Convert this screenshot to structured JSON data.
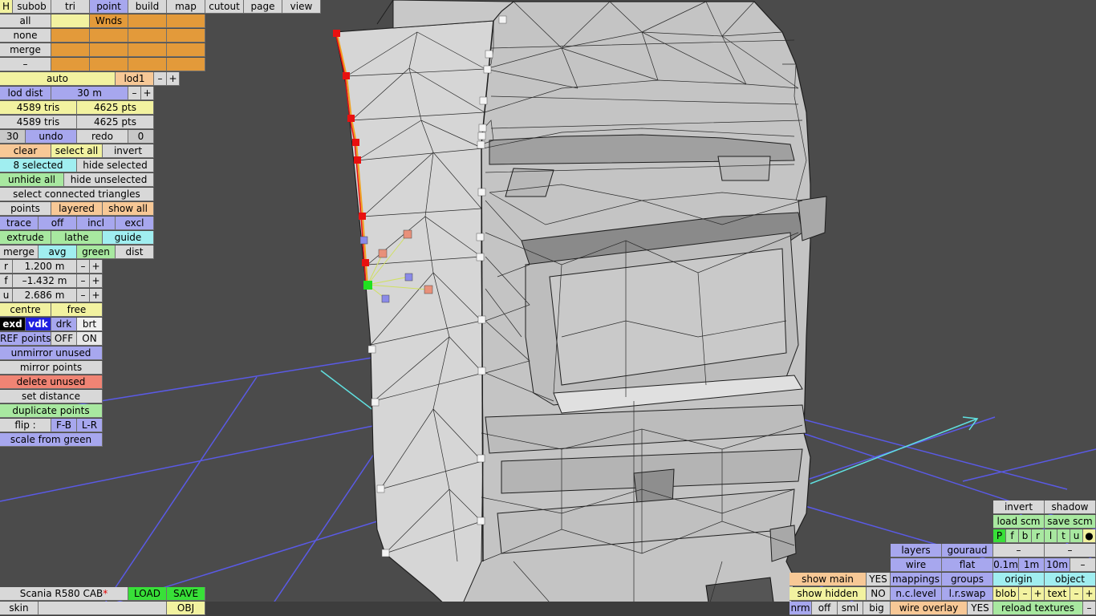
{
  "top_menu": {
    "h": "H",
    "subob": "subob",
    "tri": "tri",
    "point": "point",
    "build": "build",
    "map": "map",
    "cutout": "cutout",
    "page": "page",
    "view": "view"
  },
  "select_panel": {
    "all": "all",
    "none": "none",
    "merge": "merge",
    "dash": "–",
    "wnds": "Wnds"
  },
  "lod": {
    "auto": "auto",
    "lod1": "lod1",
    "minus": "–",
    "plus": "+",
    "lod_dist": "lod dist",
    "dist_value": "30 m"
  },
  "stats": {
    "tris_1": "4589 tris",
    "pts_1": "4625 pts",
    "tris_2": "4589 tris",
    "pts_2": "4625 pts"
  },
  "undo": {
    "count_left": "30",
    "undo": "undo",
    "redo": "redo",
    "count_right": "0"
  },
  "selection": {
    "clear": "clear",
    "select_all": "select all",
    "invert": "invert",
    "selected": "8 selected",
    "hide_selected": "hide selected",
    "unhide_all": "unhide all",
    "hide_unselected": "hide unselected",
    "select_connected": "select connected triangles"
  },
  "modes": {
    "points": "points",
    "layered": "layered",
    "show_all": "show all",
    "trace": "trace",
    "off": "off",
    "incl": "incl",
    "excl": "excl",
    "extrude": "extrude",
    "lathe": "lathe",
    "guide": "guide",
    "merge": "merge",
    "avg": "avg",
    "green": "green",
    "dist": "dist"
  },
  "coords": {
    "r_label": "r",
    "r_value": "1.200 m",
    "f_label": "f",
    "f_value": "–1.432 m",
    "u_label": "u",
    "u_value": "2.686 m",
    "minus": "–",
    "plus": "+"
  },
  "tools": {
    "centre": "centre",
    "free": "free",
    "exd": "exd",
    "vdk": "vdk",
    "drk": "drk",
    "brt": "brt",
    "ref_points": "REF points",
    "ref_off": "OFF",
    "ref_on": "ON",
    "unmirror_unused": "unmirror unused",
    "mirror_points": "mirror points",
    "delete_unused": "delete unused",
    "set_distance": "set distance",
    "duplicate_points": "duplicate points",
    "flip": "flip :",
    "flip_fb": "F-B",
    "flip_lr": "L-R",
    "scale_from_green": "scale from green"
  },
  "file_bar": {
    "model_name": "Scania R580 CAB",
    "modified_star": "*",
    "load": "LOAD",
    "save": "SAVE",
    "skin": "skin",
    "obj": "OBJ"
  },
  "view_panel": {
    "invert": "invert",
    "shadow": "shadow",
    "load_scm": "load scm",
    "save_scm": "save scm",
    "letters": [
      "P",
      "f",
      "b",
      "r",
      "l",
      "t",
      "u",
      "●"
    ],
    "dash": "–",
    "layers": "layers",
    "gouraud": "gouraud",
    "wire": "wire",
    "flat": "flat",
    "mappings": "mappings",
    "groups": "groups",
    "nc_level": "n.c.level",
    "lr_swap": "l.r.swap",
    "wire_overlay": "wire overlay",
    "wire_overlay_value": "YES",
    "g01": "0.1m",
    "g1": "1m",
    "g10": "10m",
    "origin": "origin",
    "object": "object",
    "blob": "blob",
    "text": "text",
    "minus": "–",
    "plus": "+",
    "reload_textures": "reload textures",
    "show_main": "show main",
    "show_main_value": "YES",
    "show_hidden": "show hidden",
    "show_hidden_value": "NO",
    "nrm": "nrm",
    "off": "off",
    "sml": "sml",
    "big": "big"
  },
  "colors": {
    "background": "#4a4a4a",
    "grid": "#5a5ae6",
    "axis": "#60e0e0",
    "mesh_fill": "#c4c4c4",
    "selected_point": "#e81010",
    "green_point": "#20e020"
  }
}
